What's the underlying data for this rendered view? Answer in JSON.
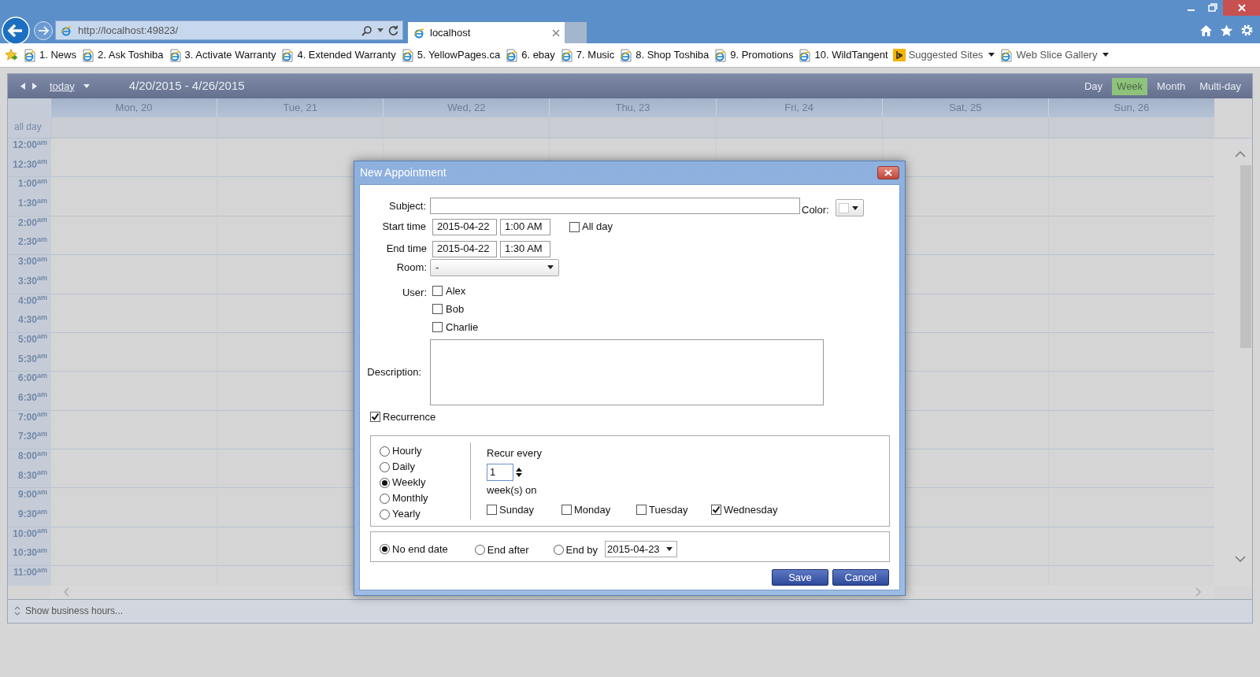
{
  "browser": {
    "url": "http://localhost:49823/",
    "tab": {
      "title": "localhost"
    },
    "favorites": [
      {
        "label": "1. News",
        "kind": "link"
      },
      {
        "label": "2. Ask Toshiba",
        "kind": "link"
      },
      {
        "label": "3. Activate Warranty",
        "kind": "link"
      },
      {
        "label": "4. Extended Warranty",
        "kind": "link"
      },
      {
        "label": "5. YellowPages.ca",
        "kind": "link"
      },
      {
        "label": "6. ebay",
        "kind": "link"
      },
      {
        "label": "7. Music",
        "kind": "link"
      },
      {
        "label": "8. Shop Toshiba",
        "kind": "link"
      },
      {
        "label": "9. Promotions",
        "kind": "link"
      },
      {
        "label": "10. WildTangent",
        "kind": "link"
      },
      {
        "label": "Suggested Sites",
        "kind": "bing-menu"
      },
      {
        "label": "Web Slice Gallery",
        "kind": "menu"
      }
    ]
  },
  "calendar": {
    "today": "today",
    "range": "4/20/2015 - 4/26/2015",
    "views": [
      {
        "label": "Day",
        "selected": false
      },
      {
        "label": "Week",
        "selected": true
      },
      {
        "label": "Month",
        "selected": false
      },
      {
        "label": "Multi-day",
        "selected": false
      }
    ],
    "days": [
      "Mon, 20",
      "Tue, 21",
      "Wed, 22",
      "Thu, 23",
      "Fri, 24",
      "Sat, 25",
      "Sun, 26"
    ],
    "all_day": "all day",
    "times": [
      "12:00$^{am}$",
      "12:30$^{am}$",
      "1:00$^{am}$",
      "1:30$^{am}$",
      "2:00$^{am}$",
      "2:30$^{am}$",
      "3:00$^{am}$",
      "3:30$^{am}$",
      "4:00$^{am}$",
      "4:30$^{am}$",
      "5:00$^{am}$",
      "5:30$^{am}$",
      "6:00$^{am}$",
      "6:30$^{am}$",
      "7:00$^{am}$",
      "7:30$^{am}$",
      "8:00$^{am}$",
      "8:30$^{am}$",
      "9:00$^{am}$",
      "9:30$^{am}$",
      "10:00$^{am}$",
      "10:30$^{am}$",
      "11:00$^{am}$"
    ],
    "footer": "Show business hours..."
  },
  "dialog": {
    "title": "New Appointment",
    "subject": {
      "label": "Subject:"
    },
    "color": {
      "label": "Color:"
    },
    "start": {
      "label": "Start time",
      "date": "2015-04-22",
      "time": "1:00 AM"
    },
    "all_day": {
      "label": "All day",
      "checked": false
    },
    "end": {
      "label": "End time",
      "date": "2015-04-22",
      "time": "1:30 AM"
    },
    "room": {
      "label": "Room:",
      "value": "-"
    },
    "users": {
      "label": "User:",
      "options": [
        {
          "label": "Alex",
          "checked": false
        },
        {
          "label": "Bob",
          "checked": false
        },
        {
          "label": "Charlie",
          "checked": false
        }
      ]
    },
    "description": {
      "label": "Description:"
    },
    "recurrence": {
      "label": "Recurrence",
      "checked": true,
      "frequencies": [
        {
          "label": "Hourly",
          "selected": false
        },
        {
          "label": "Daily",
          "selected": false
        },
        {
          "label": "Weekly",
          "selected": true
        },
        {
          "label": "Monthly",
          "selected": false
        },
        {
          "label": "Yearly",
          "selected": false
        }
      ],
      "recur_every": {
        "label": "Recur every",
        "value": "1",
        "unit": "week(s) on"
      },
      "days": [
        {
          "label": "Sunday",
          "checked": false
        },
        {
          "label": "Monday",
          "checked": false
        },
        {
          "label": "Tuesday",
          "checked": false
        },
        {
          "label": "Wednesday",
          "checked": true
        }
      ],
      "end_options": [
        {
          "label": "No end date",
          "selected": true
        },
        {
          "label": "End after",
          "selected": false
        },
        {
          "label": "End by",
          "selected": false,
          "date": "2015-04-23"
        }
      ]
    },
    "buttons": [
      {
        "label": "Save"
      },
      {
        "label": "Cancel"
      }
    ]
  }
}
